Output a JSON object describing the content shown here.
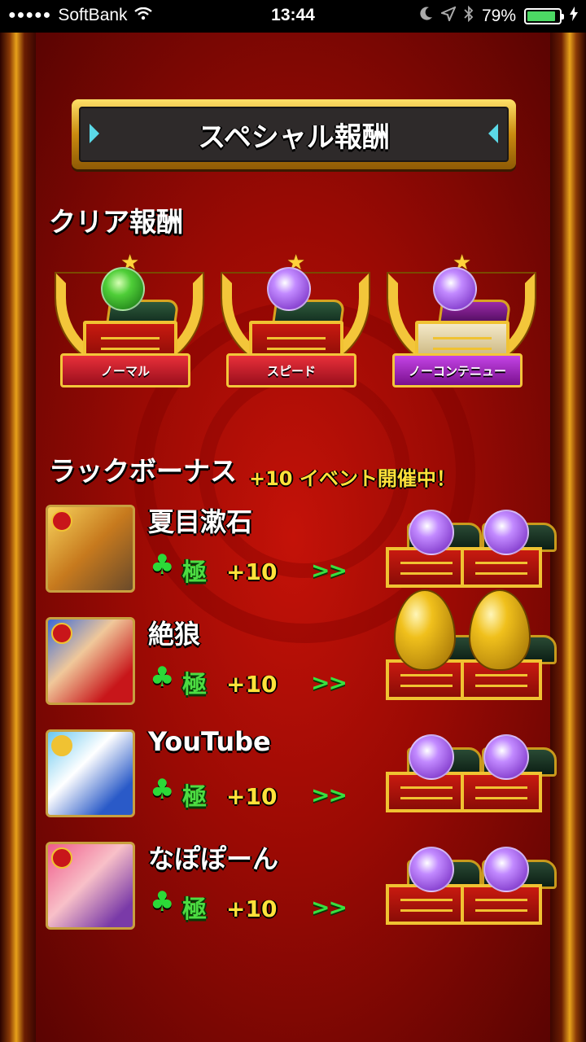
{
  "status_bar": {
    "carrier": "SoftBank",
    "time": "13:44",
    "battery": "79%"
  },
  "title": "スペシャル報酬",
  "clear_rewards": {
    "heading": "クリア報酬",
    "items": [
      {
        "label": "ノーマル",
        "orb": "green-orb-icon"
      },
      {
        "label": "スピード",
        "orb": "purple-orb-icon"
      },
      {
        "label": "ノーコンテニュー",
        "orb": "purple-orb-icon"
      }
    ]
  },
  "luck_bonus": {
    "heading": "ラックボーナス",
    "event": "+10 イベント開催中！",
    "players": [
      {
        "name": "夏目漱石",
        "rank": "極",
        "bonus": "+10",
        "arrows": ">>",
        "reward": "orb"
      },
      {
        "name": "絶狼",
        "rank": "極",
        "bonus": "+10",
        "arrows": ">>",
        "reward": "egg"
      },
      {
        "name": "YouTube",
        "rank": "極",
        "bonus": "+10",
        "arrows": ">>",
        "reward": "orb"
      },
      {
        "name": "なぽぽーん",
        "rank": "極",
        "bonus": "+10",
        "arrows": ">>",
        "reward": "orb"
      }
    ]
  },
  "colors": {
    "background_red": "#c41208",
    "gold": "#f0c232",
    "clover_green": "#2cd938",
    "event_yellow": "#ffe23a"
  }
}
